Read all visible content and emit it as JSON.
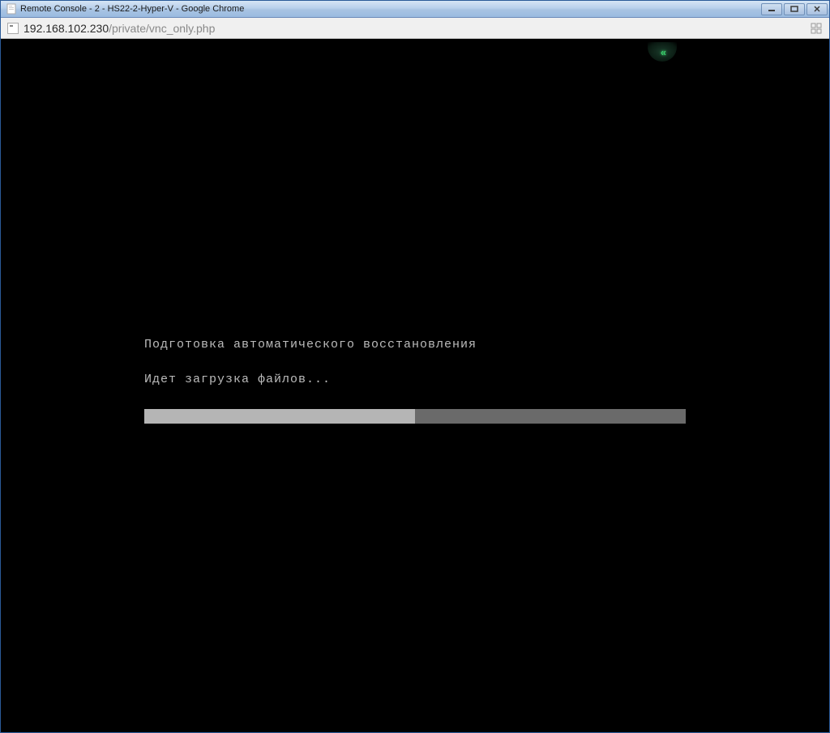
{
  "window": {
    "title": "Remote Console - 2 - HS22-2-Hyper-V - Google Chrome"
  },
  "address": {
    "host": "192.168.102.230",
    "path": "/private/vnc_only.php"
  },
  "boot": {
    "line1": "Подготовка автоматического восстановления",
    "line2": "Идет загрузка файлов...",
    "progress_percent": 50
  }
}
